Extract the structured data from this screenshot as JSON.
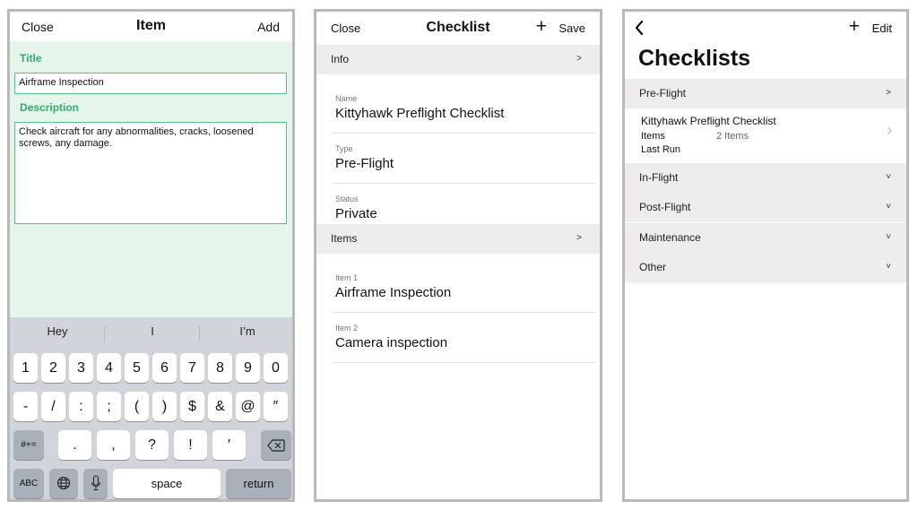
{
  "item_screen": {
    "nav": {
      "close": "Close",
      "title": "Item",
      "add": "Add"
    },
    "title_label": "Title",
    "title_value": "Airframe Inspection",
    "description_label": "Description",
    "description_value": "Check aircraft for any abnormalities, cracks, loosened screws, any damage.",
    "keyboard": {
      "suggestions": [
        "Hey",
        "I",
        "I’m"
      ],
      "row1": [
        "1",
        "2",
        "3",
        "4",
        "5",
        "6",
        "7",
        "8",
        "9",
        "0"
      ],
      "row2": [
        "-",
        "/",
        ":",
        ";",
        "(",
        ")",
        "$",
        "&",
        "@",
        "″"
      ],
      "row3": {
        "shift": "#+=",
        "keys": [
          ".",
          ",",
          "?",
          "!",
          "′"
        ]
      },
      "row4": {
        "abc": "ABC",
        "space": "space",
        "return": "return"
      }
    }
  },
  "checklist_screen": {
    "nav": {
      "close": "Close",
      "title": "Checklist",
      "save": "Save"
    },
    "info_section": "Info",
    "name_label": "Name",
    "name_value": "Kittyhawk Preflight Checklist",
    "type_label": "Type",
    "type_value": "Pre-Flight",
    "status_label": "Status",
    "status_value": "Private",
    "items_section": "Items",
    "items": [
      {
        "label": "Item 1",
        "value": "Airframe Inspection"
      },
      {
        "label": "Item 2",
        "value": "Camera inspection"
      }
    ]
  },
  "checklists_screen": {
    "nav": {
      "edit": "Edit"
    },
    "title": "Checklists",
    "sections": [
      {
        "name": "Pre-Flight"
      },
      {
        "name": "In-Flight"
      },
      {
        "name": "Post-Flight"
      },
      {
        "name": "Maintenance"
      },
      {
        "name": "Other"
      }
    ],
    "entry": {
      "title": "Kittyhawk Preflight Checklist",
      "items_label": "Items",
      "items_value": "2 Items",
      "last_run_label": "Last Run"
    }
  },
  "glyphs": {
    "chevron_right": ">",
    "chevron_down": "˅",
    "disclosure": "›",
    "plus": "+"
  }
}
